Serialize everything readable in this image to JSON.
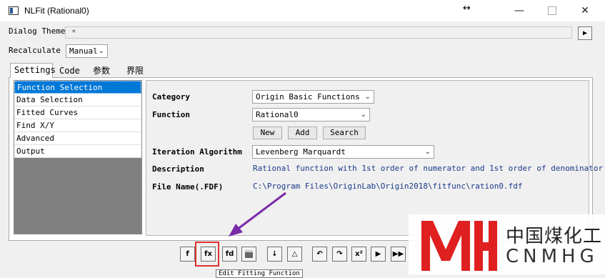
{
  "window": {
    "title": "NLFit (Rational0)",
    "controls": [
      "minimize-icon",
      "maximize-icon",
      "close-icon"
    ],
    "resize_icon": "↔"
  },
  "dialog_theme": {
    "label": "Dialog Theme",
    "value": "*"
  },
  "recalculate": {
    "label": "Recalculate",
    "value": "Manual"
  },
  "tabs": [
    {
      "label": "Settings",
      "active": true
    },
    {
      "label": "Code"
    },
    {
      "label": "参数"
    },
    {
      "label": "界限"
    }
  ],
  "tree": [
    {
      "label": "Function Selection",
      "selected": true
    },
    {
      "label": "Data Selection"
    },
    {
      "label": "Fitted Curves"
    },
    {
      "label": "Find X/Y"
    },
    {
      "label": "Advanced"
    },
    {
      "label": "Output"
    }
  ],
  "settings": {
    "category_label": "Category",
    "category_value": "Origin Basic Functions",
    "function_label": "Function",
    "function_value": "Rational0",
    "buttons": {
      "new": "New",
      "add": "Add",
      "search": "Search"
    },
    "iteration_label": "Iteration Algorithm",
    "iteration_value": "Levenberg Marquardt",
    "description_label": "Description",
    "description_value": "Rational function with 1st order of numerator and 1st order of denominator",
    "filename_label": "File Name(.FDF)",
    "filename_value": "C:\\Program Files\\OriginLab\\Origin2018\\fitfunc\\ration0.fdf"
  },
  "toolbar_icons": [
    "fit-function-icon",
    "function-builder-icon",
    "fit-settings-icon",
    "save-icon",
    "sort-icon",
    "parameter-icon",
    "undo-icon",
    "one-iteration-icon",
    "chi-square-icon",
    "fit-until-converged-icon",
    "fit-icon"
  ],
  "tooltip": "Edit Fitting Function",
  "watermark": {
    "cn": "中国煤化工",
    "en": "CNMHG",
    "logo_color": "#e02020"
  },
  "colors": {
    "selection": "#0078d7",
    "arrow": "#7a2aa8",
    "highlight": "#e03030"
  }
}
